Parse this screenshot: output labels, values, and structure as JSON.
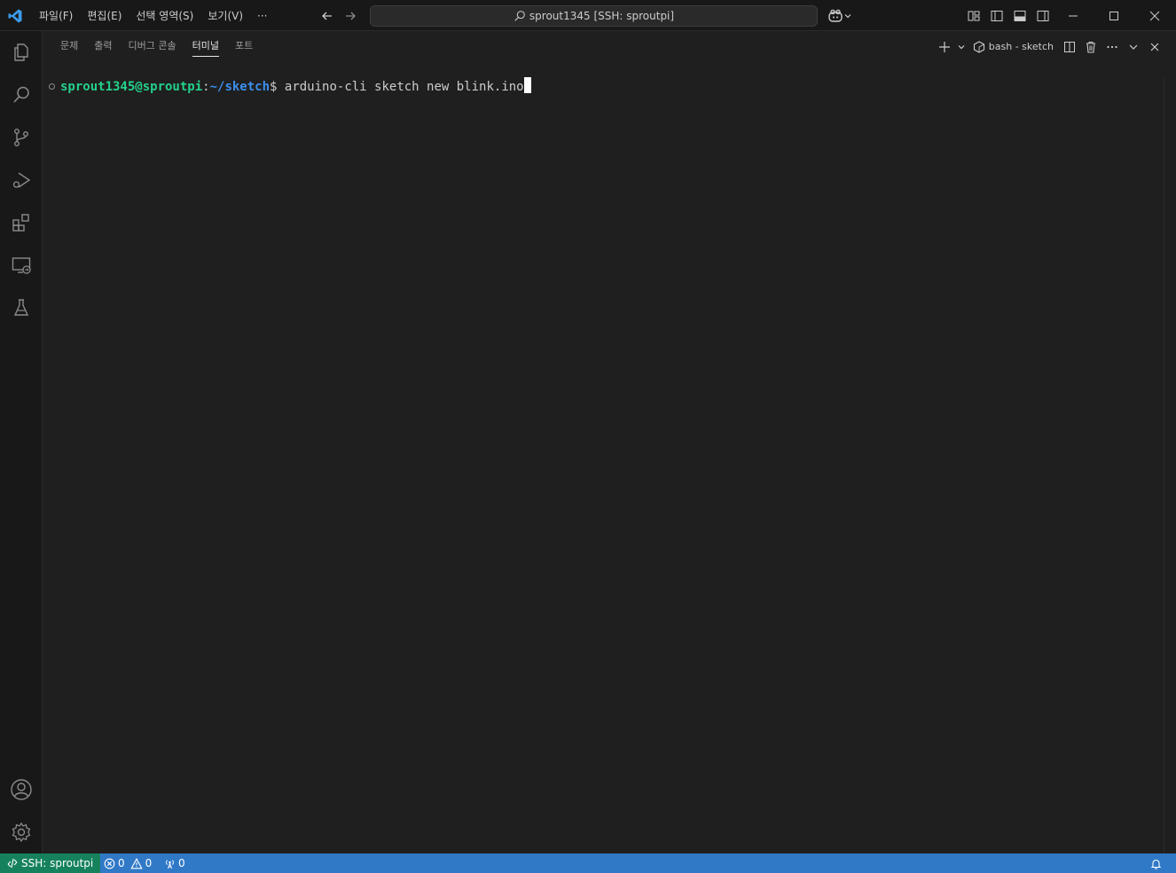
{
  "titlebar": {
    "menu": [
      "파일(F)",
      "편집(E)",
      "선택 영역(S)",
      "보기(V)",
      "···"
    ],
    "command_center": "sprout1345 [SSH: sproutpi]"
  },
  "panel": {
    "tabs": [
      "문제",
      "출력",
      "디버그 콘솔",
      "터미널",
      "포트"
    ],
    "active_tab": "터미널",
    "terminal_name": "bash - sketch"
  },
  "terminal": {
    "prompt_user": "sprout1345@sproutpi",
    "prompt_sep": ":",
    "prompt_path": "~/sketch",
    "prompt_dollar": "$ ",
    "command": "arduino-cli sketch new blink.ino"
  },
  "statusbar": {
    "remote": "SSH: sproutpi",
    "errors": "0",
    "warnings": "0",
    "ports": "0"
  },
  "colors": {
    "accent": "#0078d4",
    "statusbar": "#3079c7",
    "remote": "#16825d",
    "prompt_user": "#23d18b",
    "prompt_path": "#3b8eea"
  }
}
